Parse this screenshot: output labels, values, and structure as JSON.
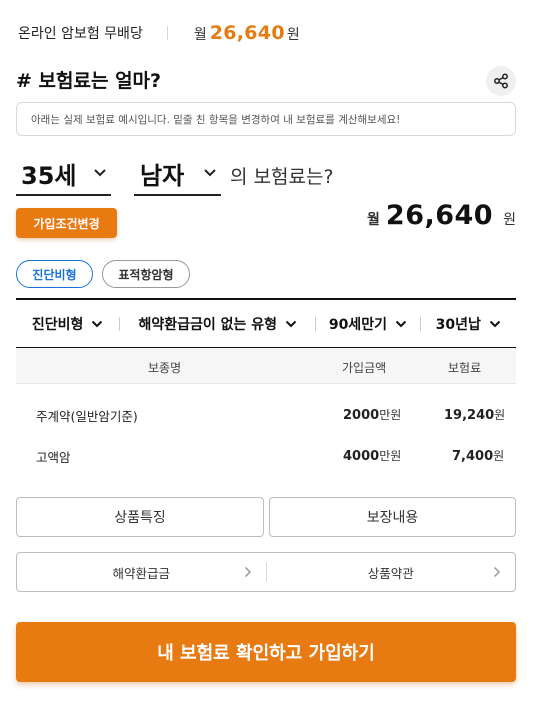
{
  "top": {
    "product_name": "온라인 암보험 무배당",
    "price_prefix": "월",
    "price_value": "26,640",
    "price_suffix": "원"
  },
  "section": {
    "title": "# 보험료는 얼마?",
    "notice": "아래는 실제 보험료 예시입니다. 밑줄 친 항목을 변경하여 내 보험료를 계산해보세요!"
  },
  "selectors": {
    "age": "35세",
    "gender": "남자",
    "question": "의 보험료는?"
  },
  "change_button": "가입조건변경",
  "premium": {
    "prefix": "월",
    "value": "26,640",
    "suffix": "원"
  },
  "chips": [
    {
      "label": "진단비형",
      "active": true
    },
    {
      "label": "표적항암형",
      "active": false
    }
  ],
  "options": [
    {
      "label": "진단비형"
    },
    {
      "label": "해약환급금이 없는 유형"
    },
    {
      "label": "90세만기"
    },
    {
      "label": "30년납"
    }
  ],
  "table": {
    "headers": [
      "보종명",
      "가입금액",
      "보험료"
    ],
    "rows": [
      {
        "name": "주계약(일반암기준)",
        "amount": "2000",
        "amount_unit": "만원",
        "premium": "19,240",
        "premium_unit": "원"
      },
      {
        "name": "고액암",
        "amount": "4000",
        "amount_unit": "만원",
        "premium": "7,400",
        "premium_unit": "원"
      }
    ]
  },
  "buttons": {
    "features": "상품특징",
    "coverage": "보장내용"
  },
  "links": {
    "refund": "해약환급금",
    "terms": "상품약관"
  },
  "cta": "내 보험료 확인하고 가입하기",
  "colors": {
    "accent": "#e87a12",
    "highlight": "#fde9d6",
    "chip_active": "#1a73d9"
  }
}
